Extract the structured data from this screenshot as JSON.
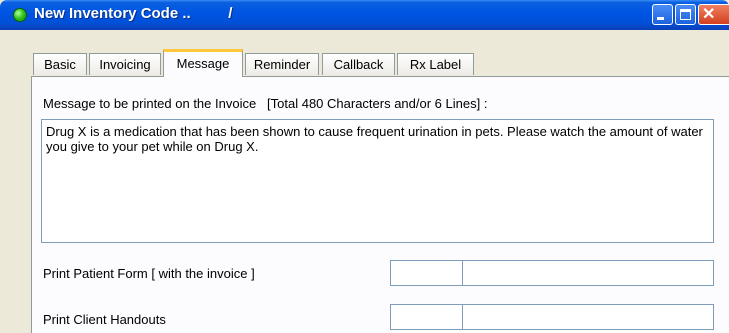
{
  "window": {
    "title": "New Inventory Code ..         /"
  },
  "tabs": [
    {
      "label": "Basic"
    },
    {
      "label": "Invoicing"
    },
    {
      "label": "Message"
    },
    {
      "label": "Reminder"
    },
    {
      "label": "Callback"
    },
    {
      "label": "Rx Label"
    }
  ],
  "active_tab": "Message",
  "message": {
    "label": "Message to be printed on the Invoice   [Total 480 Characters and/or 6 Lines] :",
    "text": "Drug X is a medication that has been shown to cause frequent urination in pets.  Please watch the amount of water you give to your pet while on Drug X."
  },
  "rows": [
    {
      "label": "Print Patient Form [ with the invoice ]",
      "code_value": "",
      "description_value": ""
    },
    {
      "label": "Print Client Handouts",
      "code_value": "",
      "description_value": ""
    }
  ],
  "icons": [
    "status-dot-icon",
    "minimize-icon",
    "maximize-icon",
    "close-icon"
  ],
  "colors": {
    "title_bar": "#0054e3",
    "dialog_bg": "#ece9d8",
    "active_tab_accent": "#ffc83c",
    "field_border": "#7f9db9"
  }
}
